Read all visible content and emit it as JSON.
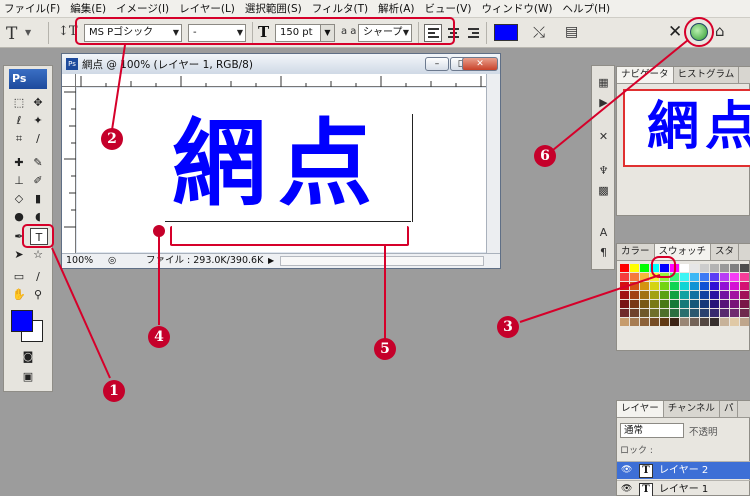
{
  "menu": [
    "ファイル(F)",
    "編集(E)",
    "イメージ(I)",
    "レイヤー(L)",
    "選択範囲(S)",
    "フィルタ(T)",
    "解析(A)",
    "ビュー(V)",
    "ウィンドウ(W)",
    "ヘルプ(H)"
  ],
  "options": {
    "font_family": "MS Pゴシック",
    "font_style": "-",
    "font_size": "150 pt",
    "antialias": "シャープ",
    "text_color": "#0000ff",
    "tool_glyph": "T",
    "size_glyph": "T",
    "aa_glyph": "a a",
    "cancel_glyph": "✕"
  },
  "toolbox": {
    "logo": "Ps",
    "foreground_color": "#0000ff",
    "background_color": "#ffffff"
  },
  "document": {
    "title": "網点 @ 100% (レイヤー 1, RGB/8)",
    "canvas_text": "網点",
    "zoom": "100%",
    "file_info": "ファイル : 293.0K/390.6K"
  },
  "navigator": {
    "tabs": [
      "ナビゲータ",
      "ヒストグラム"
    ],
    "preview_text": "網点"
  },
  "swatch_panel": {
    "tabs": [
      "カラー",
      "スウォッチ",
      "スタ"
    ]
  },
  "layers_panel": {
    "tabs": [
      "レイヤー",
      "チャンネル",
      "パ"
    ],
    "blend_mode": "通常",
    "opacity_label": "不透明",
    "lock_label": "ロック :",
    "layers": [
      {
        "name": "レイヤー 2",
        "selected": true
      },
      {
        "name": "レイヤー 1",
        "selected": false
      }
    ]
  },
  "callouts": [
    "1",
    "2",
    "3",
    "4",
    "5",
    "6"
  ],
  "colors": {
    "annotation_red": "#d6002a",
    "text_blue": "#0000ff"
  }
}
